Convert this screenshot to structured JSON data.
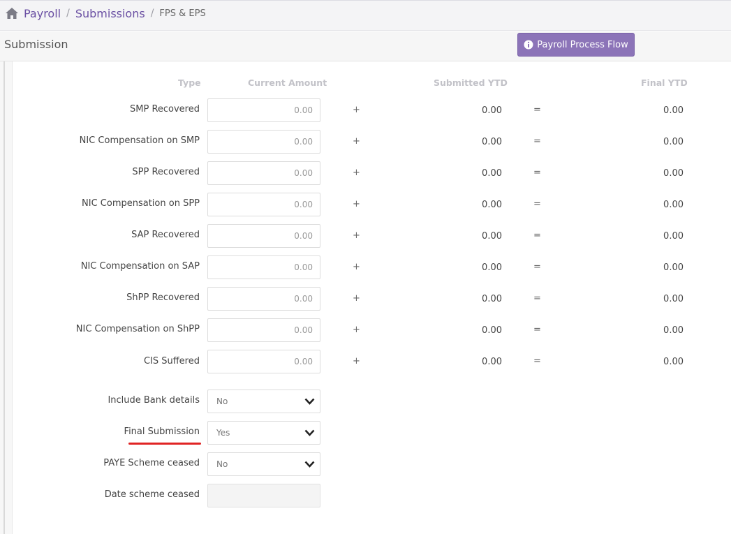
{
  "breadcrumb": {
    "items": [
      "Payroll",
      "Submissions"
    ],
    "separator": "/",
    "current": "FPS & EPS"
  },
  "header": {
    "title": "Submission",
    "flow_button": "Payroll Process Flow"
  },
  "table": {
    "headers": {
      "type": "Type",
      "current": "Current Amount",
      "submitted": "Submitted YTD",
      "final": "Final YTD"
    },
    "plus": "+",
    "equals": "=",
    "rows": [
      {
        "label": "SMP Recovered",
        "current": "0.00",
        "submitted": "0.00",
        "final": "0.00"
      },
      {
        "label": "NIC Compensation on SMP",
        "current": "0.00",
        "submitted": "0.00",
        "final": "0.00"
      },
      {
        "label": "SPP Recovered",
        "current": "0.00",
        "submitted": "0.00",
        "final": "0.00"
      },
      {
        "label": "NIC Compensation on SPP",
        "current": "0.00",
        "submitted": "0.00",
        "final": "0.00"
      },
      {
        "label": "SAP Recovered",
        "current": "0.00",
        "submitted": "0.00",
        "final": "0.00"
      },
      {
        "label": "NIC Compensation on SAP",
        "current": "0.00",
        "submitted": "0.00",
        "final": "0.00"
      },
      {
        "label": "ShPP Recovered",
        "current": "0.00",
        "submitted": "0.00",
        "final": "0.00"
      },
      {
        "label": "NIC Compensation on ShPP",
        "current": "0.00",
        "submitted": "0.00",
        "final": "0.00"
      },
      {
        "label": "CIS Suffered",
        "current": "0.00",
        "submitted": "0.00",
        "final": "0.00"
      }
    ]
  },
  "options": {
    "include_bank": {
      "label": "Include Bank details",
      "value": "No"
    },
    "final_submission": {
      "label": "Final Submission",
      "value": "Yes"
    },
    "paye_ceased": {
      "label": "PAYE Scheme ceased",
      "value": "No"
    },
    "date_ceased": {
      "label": "Date scheme ceased",
      "value": ""
    }
  },
  "icons": {
    "home": "home-icon",
    "info": "info-icon",
    "dropdown": "chevron-down-icon"
  },
  "colors": {
    "brand": "#6a4fa3",
    "button": "#8c74b8",
    "highlight": "#e02424"
  }
}
